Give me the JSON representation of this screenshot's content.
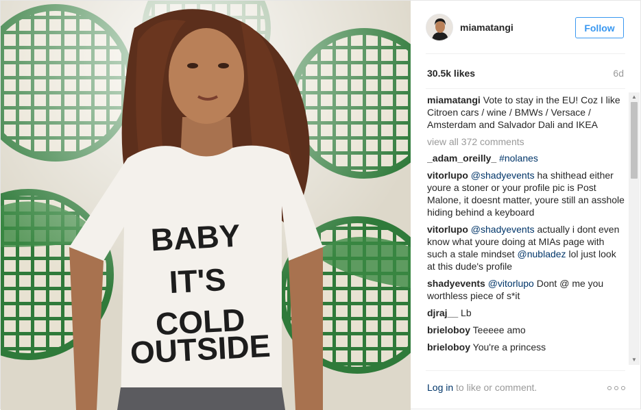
{
  "post": {
    "image_alt": "Woman with long wavy hair wearing a white t-shirt in front of green globe mural",
    "shirt_text": [
      "BABY",
      "IT'S",
      "COLD",
      "OUTSIDE"
    ]
  },
  "header": {
    "username": "miamatangi",
    "follow_label": "Follow"
  },
  "stats": {
    "likes": "30.5k likes",
    "age": "6d"
  },
  "caption": {
    "author": "miamatangi",
    "text": "Vote to stay in the EU! Coz I like Citroen cars / wine / BMWs / Versace / Amsterdam and Salvador Dali and IKEA"
  },
  "view_all_comments": "view all 372 comments",
  "comments": [
    {
      "author": "_adam_oreilly_",
      "parts": [
        {
          "type": "hashtag",
          "text": "#nolanes"
        }
      ]
    },
    {
      "author": "vitorlupo",
      "parts": [
        {
          "type": "mention",
          "text": "@shadyevents"
        },
        {
          "type": "text",
          "text": " ha shithead either youre a stoner or your profile pic is Post Malone, it doesnt matter, youre still an asshole hiding behind a keyboard"
        }
      ]
    },
    {
      "author": "vitorlupo",
      "parts": [
        {
          "type": "mention",
          "text": "@shadyevents"
        },
        {
          "type": "text",
          "text": " actually i dont even know what youre doing at MIAs page with such a stale mindset "
        },
        {
          "type": "mention",
          "text": "@nubladez"
        },
        {
          "type": "text",
          "text": " lol just look at this dude's profile"
        }
      ]
    },
    {
      "author": "shadyevents",
      "parts": [
        {
          "type": "mention",
          "text": "@vitorlupo"
        },
        {
          "type": "text",
          "text": " Dont @ me you worthless piece of s*it"
        }
      ]
    },
    {
      "author": "djraj__",
      "parts": [
        {
          "type": "text",
          "text": "Lb"
        }
      ]
    },
    {
      "author": "brieloboy",
      "parts": [
        {
          "type": "text",
          "text": "Teeeee amo"
        }
      ]
    },
    {
      "author": "brieloboy",
      "parts": [
        {
          "type": "text",
          "text": "You're a princess"
        }
      ]
    }
  ],
  "footer": {
    "login_link": "Log in",
    "login_suffix": "to like or comment."
  },
  "colors": {
    "link": "#003569",
    "follow": "#3897f0",
    "muted": "#999999",
    "mural_green": "#2f7a3a"
  },
  "icons": {
    "more": "more-options-icon",
    "scroll_up": "scroll-up-arrow-icon",
    "scroll_down": "scroll-down-arrow-icon"
  }
}
